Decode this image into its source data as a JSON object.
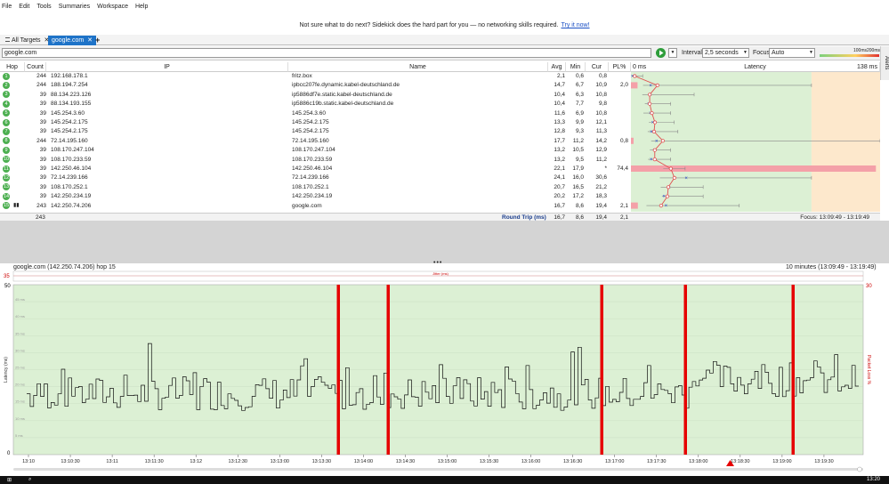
{
  "menu": [
    "File",
    "Edit",
    "Tools",
    "Summaries",
    "Workspace",
    "Help"
  ],
  "banner": {
    "text": "Not sure what to do next? Sidekick does the hard part for you — no networking skills required.",
    "link": "Try it now!"
  },
  "tabs": {
    "all_targets": "All Targets",
    "current": "google.com",
    "add": "+"
  },
  "toolbar": {
    "target_value": "google.com",
    "interval_label": "Interval",
    "interval_value": "2,5 seconds",
    "focus_label": "Focus",
    "focus_value": "Auto",
    "scale_100": "100ms",
    "scale_200": "200ms",
    "alerts_label": "Alerts"
  },
  "columns": {
    "hop": "Hop",
    "count": "Count",
    "ip": "IP",
    "name": "Name",
    "avg": "Avg",
    "min": "Min",
    "cur": "Cur",
    "pl": "PL%",
    "lat0": "0 ms",
    "latency": "Latency",
    "latmax": "138 ms"
  },
  "hops": [
    {
      "hop": "1",
      "count": "244",
      "ip": "192.168.178.1",
      "name": "fritz.box",
      "avg": "2,1",
      "min": "0,6",
      "cur": "0,8",
      "pl": "",
      "avg_v": 2.1,
      "min_v": 0.6,
      "max_v": 6.5,
      "cur_v": 0.8,
      "pl_v": 0
    },
    {
      "hop": "2",
      "count": "244",
      "ip": "188.194.7.254",
      "name": "ipbcc207fe.dynamic.kabel-deutschland.de",
      "avg": "14,7",
      "min": "6,7",
      "cur": "10,9",
      "pl": "2,0",
      "avg_v": 14.7,
      "min_v": 6.7,
      "max_v": 100,
      "cur_v": 10.9,
      "pl_v": 2.0
    },
    {
      "hop": "3",
      "count": "39",
      "ip": "88.134.223.126",
      "name": "ip5886df7e.static.kabel-deutschland.de",
      "avg": "10,4",
      "min": "6,3",
      "cur": "10,8",
      "pl": "",
      "avg_v": 10.4,
      "min_v": 6.3,
      "max_v": 35,
      "cur_v": 10.8,
      "pl_v": 0
    },
    {
      "hop": "4",
      "count": "39",
      "ip": "88.134.193.155",
      "name": "ip5886c19b.static.kabel-deutschland.de",
      "avg": "10,4",
      "min": "7,7",
      "cur": "9,8",
      "pl": "",
      "avg_v": 10.4,
      "min_v": 7.7,
      "max_v": 22,
      "cur_v": 9.8,
      "pl_v": 0
    },
    {
      "hop": "5",
      "count": "39",
      "ip": "145.254.3.60",
      "name": "145.254.3.60",
      "avg": "11,6",
      "min": "6,9",
      "cur": "10,8",
      "pl": "",
      "avg_v": 11.6,
      "min_v": 6.9,
      "max_v": 22,
      "cur_v": 10.8,
      "pl_v": 0
    },
    {
      "hop": "6",
      "count": "39",
      "ip": "145.254.2.175",
      "name": "145.254.2.175",
      "avg": "13,3",
      "min": "9,9",
      "cur": "12,1",
      "pl": "",
      "avg_v": 13.3,
      "min_v": 9.9,
      "max_v": 24,
      "cur_v": 12.1,
      "pl_v": 0
    },
    {
      "hop": "7",
      "count": "39",
      "ip": "145.254.2.175",
      "name": "145.254.2.175",
      "avg": "12,8",
      "min": "9,3",
      "cur": "11,3",
      "pl": "",
      "avg_v": 12.8,
      "min_v": 9.3,
      "max_v": 26,
      "cur_v": 11.3,
      "pl_v": 0
    },
    {
      "hop": "8",
      "count": "244",
      "ip": "72.14.195.160",
      "name": "72.14.195.160",
      "avg": "17,7",
      "min": "11,2",
      "cur": "14,2",
      "pl": "0,8",
      "avg_v": 17.7,
      "min_v": 11.2,
      "max_v": 138,
      "cur_v": 14.2,
      "pl_v": 0.8
    },
    {
      "hop": "9",
      "count": "39",
      "ip": "108.170.247.104",
      "name": "108.170.247.104",
      "avg": "13,2",
      "min": "10,5",
      "cur": "12,9",
      "pl": "",
      "avg_v": 13.2,
      "min_v": 10.5,
      "max_v": 22,
      "cur_v": 12.9,
      "pl_v": 0
    },
    {
      "hop": "10",
      "count": "39",
      "ip": "108.170.233.59",
      "name": "108.170.233.59",
      "avg": "13,2",
      "min": "9,5",
      "cur": "11,2",
      "pl": "",
      "avg_v": 13.2,
      "min_v": 9.5,
      "max_v": 22,
      "cur_v": 11.2,
      "pl_v": 0
    },
    {
      "hop": "11",
      "count": "39",
      "ip": "142.250.46.104",
      "name": "142.250.46.104",
      "avg": "22,1",
      "min": "17,9",
      "cur": "*",
      "pl": "74,4",
      "avg_v": 22.1,
      "min_v": 17.9,
      "max_v": 30,
      "cur_v": null,
      "pl_v": 74.4
    },
    {
      "hop": "12",
      "count": "39",
      "ip": "72.14.239.166",
      "name": "72.14.239.166",
      "avg": "24,1",
      "min": "16,0",
      "cur": "30,6",
      "pl": "",
      "avg_v": 24.1,
      "min_v": 16.0,
      "max_v": 100,
      "cur_v": 30.6,
      "pl_v": 0
    },
    {
      "hop": "13",
      "count": "39",
      "ip": "108.170.252.1",
      "name": "108.170.252.1",
      "avg": "20,7",
      "min": "16,5",
      "cur": "21,2",
      "pl": "",
      "avg_v": 20.7,
      "min_v": 16.5,
      "max_v": 40,
      "cur_v": 21.2,
      "pl_v": 0
    },
    {
      "hop": "14",
      "count": "39",
      "ip": "142.250.234.19",
      "name": "142.250.234.19",
      "avg": "20,2",
      "min": "17,2",
      "cur": "18,3",
      "pl": "",
      "avg_v": 20.2,
      "min_v": 17.2,
      "max_v": 40,
      "cur_v": 18.3,
      "pl_v": 0
    },
    {
      "hop": "15",
      "count": "243",
      "ip": "142.250.74.206",
      "name": "google.com",
      "avg": "16,7",
      "min": "8,6",
      "cur": "19,4",
      "pl": "2,1",
      "avg_v": 16.7,
      "min_v": 8.6,
      "max_v": 60,
      "cur_v": 19.4,
      "pl_v": 2.1
    }
  ],
  "summary": {
    "count": "243",
    "label": "Round Trip (ms)",
    "avg": "16,7",
    "min": "8,6",
    "cur": "19,4",
    "pl": "2,1",
    "focus": "Focus: 13:09:49 - 13:19:49"
  },
  "history": {
    "title": "google.com (142.250.74.206) hop 15",
    "range": "10 minutes (13:09:49 - 13:19:49)",
    "jitter_label": "Jitter (ms)",
    "jitter_max": "35",
    "y_left_max": "50",
    "y_right_max": "30",
    "y_left_zero": "0",
    "ylabel": "Latency (ms)",
    "y2label": "Packet Loss %",
    "y_ticks": [
      "45 ms",
      "40 ms",
      "35 ms",
      "30 ms",
      "25 ms",
      "20 ms",
      "15 ms",
      "10 ms",
      "5 ms"
    ],
    "x_ticks": [
      "13:10",
      "13:10:30",
      "13:11",
      "13:11:30",
      "13:12",
      "13:12:30",
      "13:13:00",
      "13:13:30",
      "13:14:00",
      "13:14:30",
      "13:15:00",
      "13:15:30",
      "13:16:00",
      "13:16:30",
      "13:17:00",
      "13:17:30",
      "13:18:00",
      "13:18:30",
      "13:19:00",
      "13:19:30"
    ],
    "loss_events": [
      "13:13:37",
      "13:14:07",
      "13:16:37",
      "13:17:37",
      "13:18:42"
    ]
  },
  "taskbar": {
    "time": "13:20"
  },
  "colors": {
    "accent": "#1e73c8",
    "green_zone": "#dcf0d4",
    "orange_zone": "#fde8cc",
    "loss_red": "#e60000",
    "latency_line": "#e05050"
  }
}
